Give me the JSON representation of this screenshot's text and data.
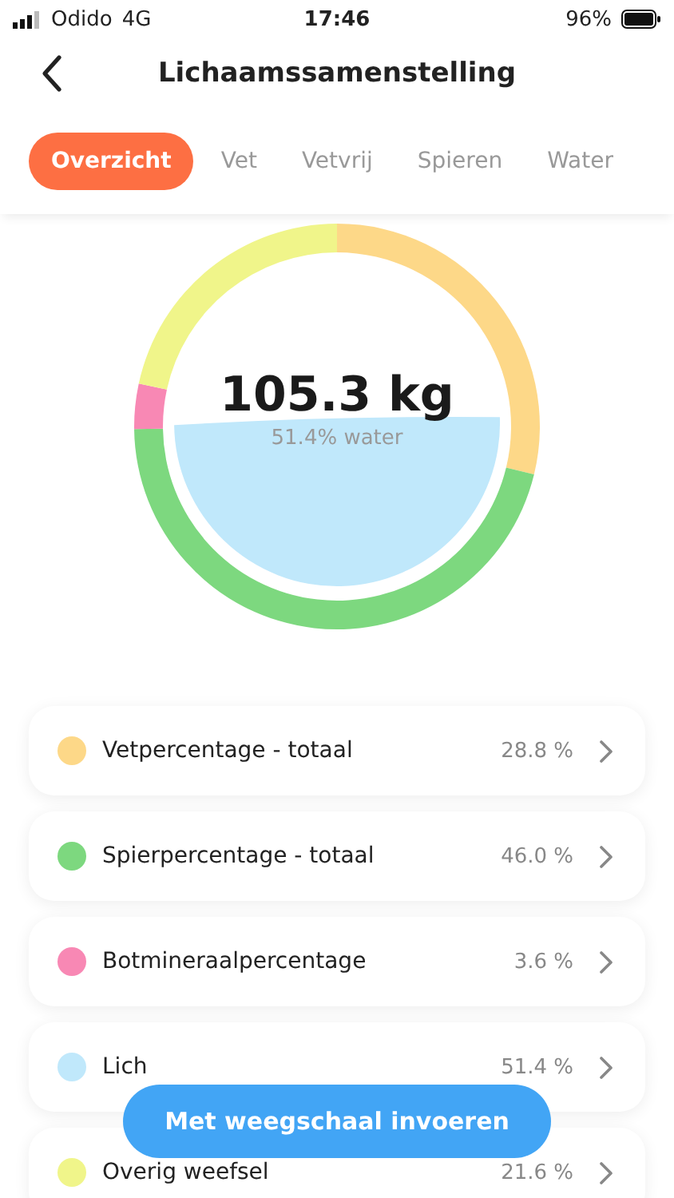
{
  "status_bar": {
    "carrier": "Odido",
    "network": "4G",
    "time": "17:46",
    "battery": "96%"
  },
  "header": {
    "title": "Lichaamssamenstelling"
  },
  "tabs": [
    {
      "label": "Overzicht",
      "selected": true
    },
    {
      "label": "Vet",
      "selected": false
    },
    {
      "label": "Vetvrij",
      "selected": false
    },
    {
      "label": "Spieren",
      "selected": false
    },
    {
      "label": "Water",
      "selected": false
    }
  ],
  "gauge": {
    "weight": "105.3 kg",
    "caption": "51.4% water"
  },
  "rows": [
    {
      "label": "Vetpercentage - totaal",
      "value": "28.8 %",
      "color": "#fdd888",
      "kind": "segment"
    },
    {
      "label": "Spierpercentage - totaal",
      "value": "46.0 %",
      "color": "#7dd87f",
      "kind": "segment"
    },
    {
      "label": "Botmineraalpercentage",
      "value": "3.6 %",
      "color": "#f888b4",
      "kind": "segment"
    },
    {
      "label": "Lich",
      "value": "51.4 %",
      "color": "#c0e8fb",
      "kind": "fill"
    },
    {
      "label": "Overig weefsel",
      "value": "21.6 %",
      "color": "#f0f58a",
      "kind": "segment"
    }
  ],
  "action_button": {
    "label": "Met weegschaal invoeren"
  }
}
